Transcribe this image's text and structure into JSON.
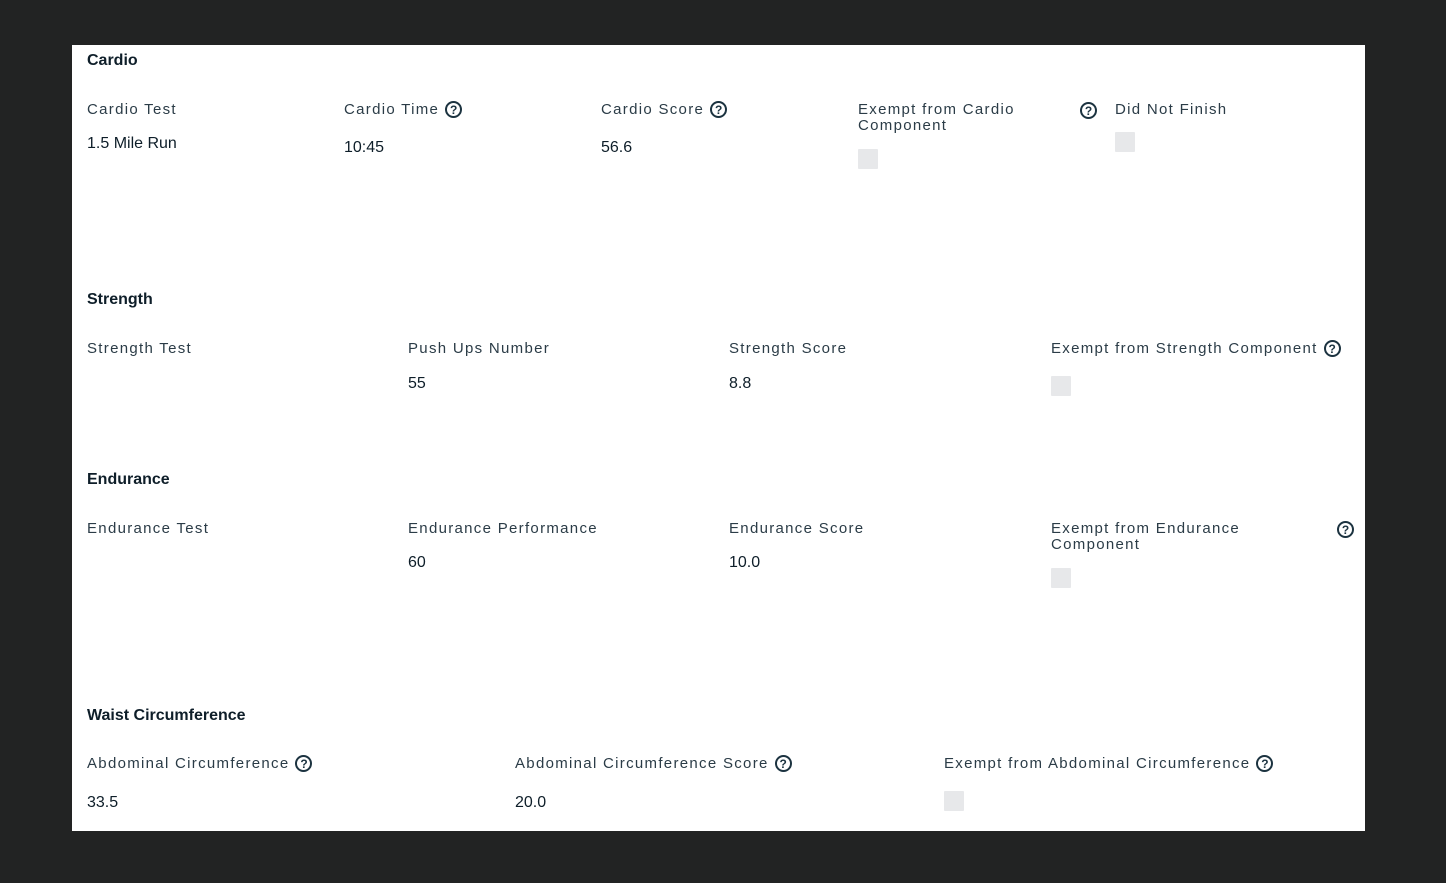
{
  "cardio": {
    "title": "Cardio",
    "test_label": "Cardio Test",
    "test_value": "1.5 Mile Run",
    "time_label": "Cardio Time",
    "time_value": "10:45",
    "score_label": "Cardio Score",
    "score_value": "56.6",
    "exempt_label": "Exempt from Cardio Component",
    "dnf_label": "Did Not Finish"
  },
  "strength": {
    "title": "Strength",
    "test_label": "Strength Test",
    "pushups_label": "Push Ups Number",
    "pushups_value": "55",
    "score_label": "Strength Score",
    "score_value": "8.8",
    "exempt_label": "Exempt from Strength Component"
  },
  "endurance": {
    "title": "Endurance",
    "test_label": "Endurance Test",
    "performance_label": "Endurance Performance",
    "performance_value": "60",
    "score_label": "Endurance Score",
    "score_value": "10.0",
    "exempt_label": "Exempt from Endurance Component"
  },
  "waist": {
    "title": "Waist Circumference",
    "abd_label": "Abdominal Circumference",
    "abd_value": "33.5",
    "abd_score_label": "Abdominal Circumference Score",
    "abd_score_value": "20.0",
    "exempt_label": "Exempt from Abdominal Circumference"
  },
  "icons": {
    "help": "?"
  },
  "colors": {
    "background": "#222323",
    "panel": "#ffffff",
    "text": "#1b2a35",
    "checkbox": "#e7e8ea"
  }
}
